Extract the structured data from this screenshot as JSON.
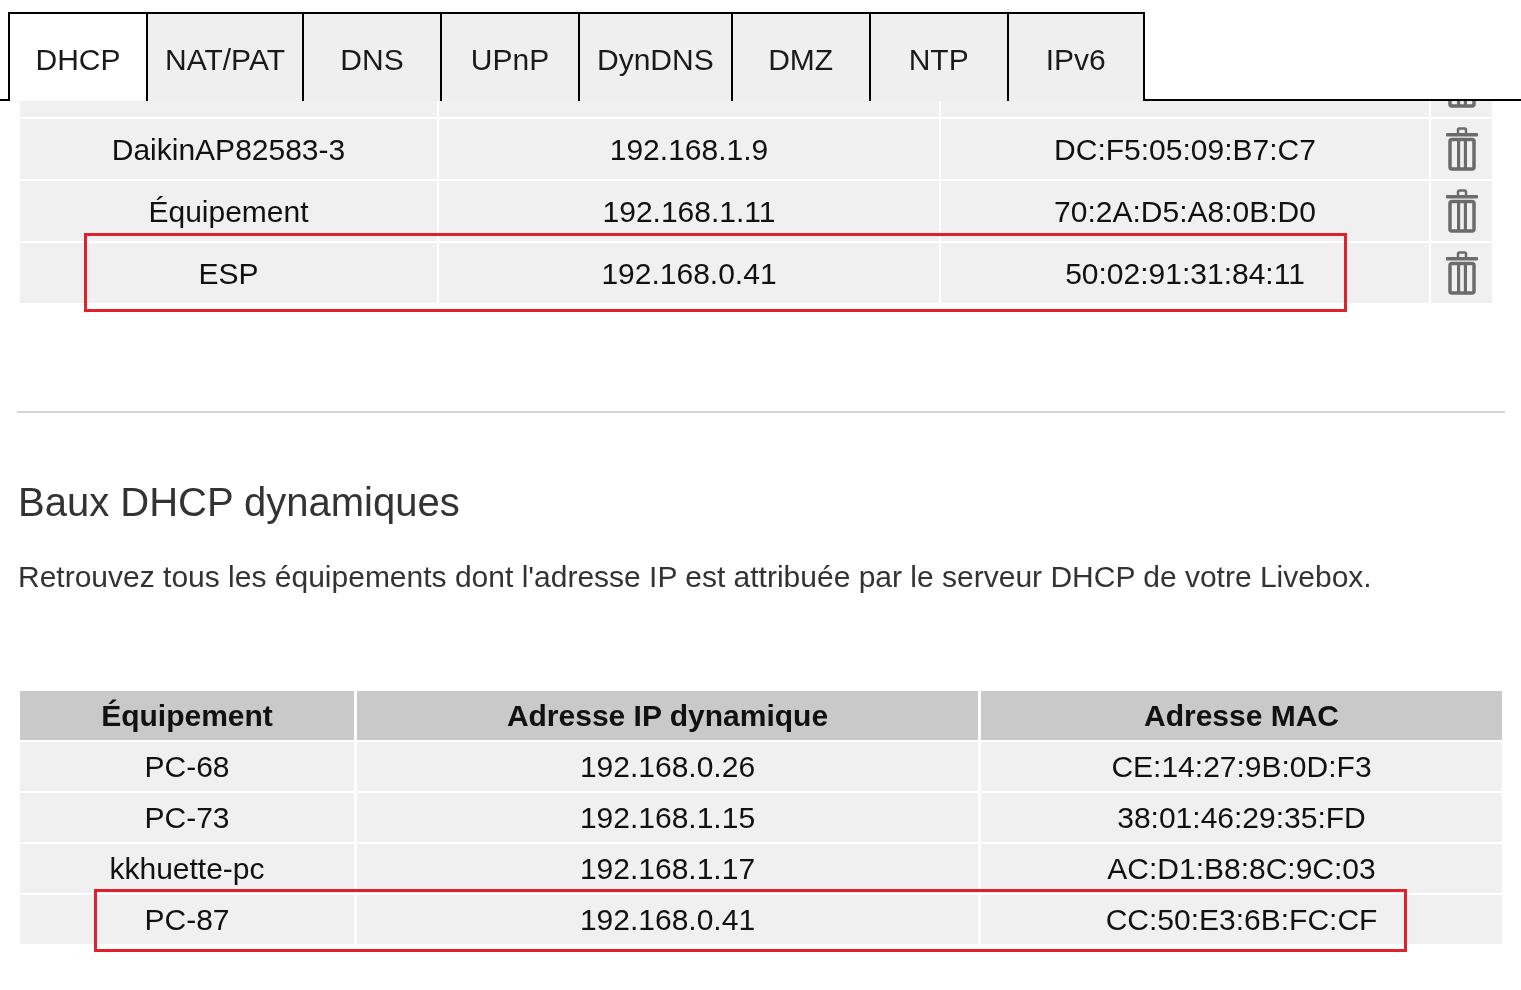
{
  "tabs": [
    {
      "label": "DHCP",
      "selected": true
    },
    {
      "label": "NAT/PAT",
      "selected": false
    },
    {
      "label": "DNS",
      "selected": false
    },
    {
      "label": "UPnP",
      "selected": false
    },
    {
      "label": "DynDNS",
      "selected": false
    },
    {
      "label": "DMZ",
      "selected": false
    },
    {
      "label": "NTP",
      "selected": false
    },
    {
      "label": "IPv6",
      "selected": false
    }
  ],
  "static_leases": {
    "rows": [
      {
        "device": "DaikinAP82583-3",
        "ip": "192.168.1.9",
        "mac": "DC:F5:05:09:B7:C7",
        "highlighted": false
      },
      {
        "device": "Équipement",
        "ip": "192.168.1.11",
        "mac": "70:2A:D5:A8:0B:D0",
        "highlighted": false
      },
      {
        "device": "ESP",
        "ip": "192.168.0.41",
        "mac": "50:02:91:31:84:11",
        "highlighted": true
      }
    ]
  },
  "dynamic_leases": {
    "title": "Baux DHCP dynamiques",
    "description": "Retrouvez tous les équipements dont l'adresse IP est attribuée par le serveur DHCP de votre Livebox.",
    "columns": [
      "Équipement",
      "Adresse IP dynamique",
      "Adresse MAC"
    ],
    "rows": [
      {
        "device": "PC-68",
        "ip": "192.168.0.26",
        "mac": "CE:14:27:9B:0D:F3",
        "highlighted": false
      },
      {
        "device": "PC-73",
        "ip": "192.168.1.15",
        "mac": "38:01:46:29:35:FD",
        "highlighted": false
      },
      {
        "device": "kkhuette-pc",
        "ip": "192.168.1.17",
        "mac": "AC:D1:B8:8C:9C:03",
        "highlighted": false
      },
      {
        "device": "PC-87",
        "ip": "192.168.0.41",
        "mac": "CC:50:E3:6B:FC:CF",
        "highlighted": true
      }
    ]
  }
}
